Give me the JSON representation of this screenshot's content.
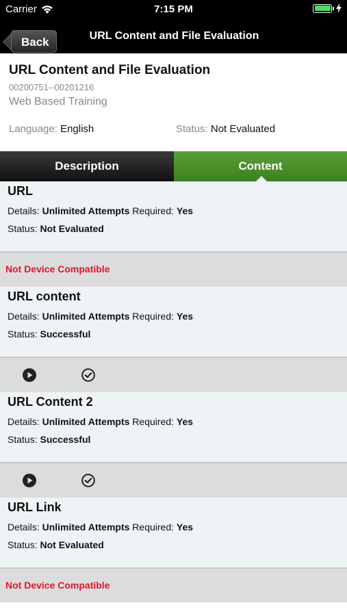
{
  "status_bar": {
    "carrier": "Carrier",
    "time": "7:15 PM"
  },
  "nav": {
    "back_label": "Back",
    "title": "URL Content and File Evaluation"
  },
  "header": {
    "title": "URL Content and File Evaluation",
    "code": "00200751--00201216",
    "type": "Web Based Training",
    "language_label": "Language:",
    "language_value": "English",
    "status_label": "Status:",
    "status_value": "Not Evaluated"
  },
  "tabs": {
    "description": "Description",
    "content": "Content"
  },
  "labels": {
    "details": "Details:",
    "required": "Required:",
    "status": "Status:"
  },
  "items": [
    {
      "title": "URL",
      "details": "Unlimited Attempts",
      "required": "Yes",
      "status": "Not Evaluated",
      "footer": "Not Device Compatible"
    },
    {
      "title": "URL content",
      "details": "Unlimited Attempts",
      "required": "Yes",
      "status": "Successful",
      "footer": "actions"
    },
    {
      "title": "URL Content 2",
      "details": "Unlimited Attempts",
      "required": "Yes",
      "status": "Successful",
      "footer": "actions"
    },
    {
      "title": "URL Link",
      "details": "Unlimited Attempts",
      "required": "Yes",
      "status": "Not Evaluated",
      "footer": "Not Device Compatible"
    }
  ],
  "icons": {
    "play": "play-icon",
    "check": "check-circle-icon",
    "wifi": "wifi-icon",
    "battery": "battery-icon"
  },
  "colors": {
    "nav_bg": "#000000",
    "tab_active": "#4f942b",
    "warning_text": "#e0162b",
    "battery_fill": "#4cd964"
  }
}
